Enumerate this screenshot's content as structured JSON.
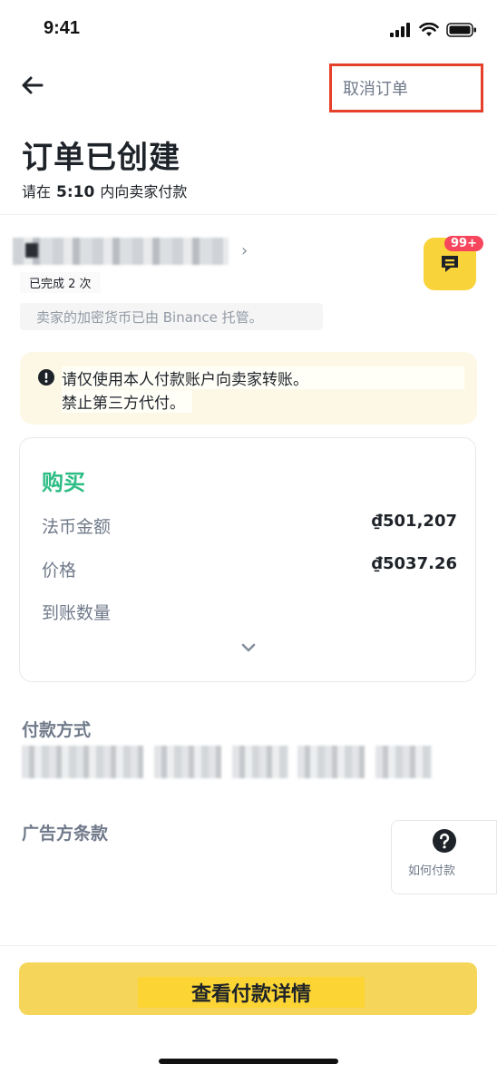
{
  "status_bar": {
    "time": "9:41"
  },
  "header": {
    "cancel_label": "取消订单"
  },
  "order": {
    "title": "订单已创建",
    "subtitle_prefix": "请在",
    "countdown": "5:10",
    "subtitle_suffix": "内向卖家付款"
  },
  "seller": {
    "completed_badge": "已完成 2 次",
    "escrow_note": "卖家的加密货币已由 Binance 托管。",
    "chat_unread": "99+"
  },
  "warning": {
    "line1": "请仅使用本人付款账户向卖家转账。",
    "line2": "禁止第三方代付。"
  },
  "details": {
    "side_label": "购买",
    "rows": [
      {
        "label": "法币金额",
        "value": "₫501,207"
      },
      {
        "label": "价格",
        "value": "₫5037.26"
      },
      {
        "label": "到账数量",
        "value": ""
      }
    ]
  },
  "payment": {
    "section_title": "付款方式"
  },
  "terms": {
    "section_title": "广告方条款"
  },
  "help": {
    "how_to_pay_label": "如何付款"
  },
  "footer": {
    "cta_label": "查看付款详情"
  },
  "colors": {
    "accent": "#fcd535",
    "buy": "#2ebd85",
    "badge": "#f6465d",
    "cancel_outline": "#e5402a"
  }
}
